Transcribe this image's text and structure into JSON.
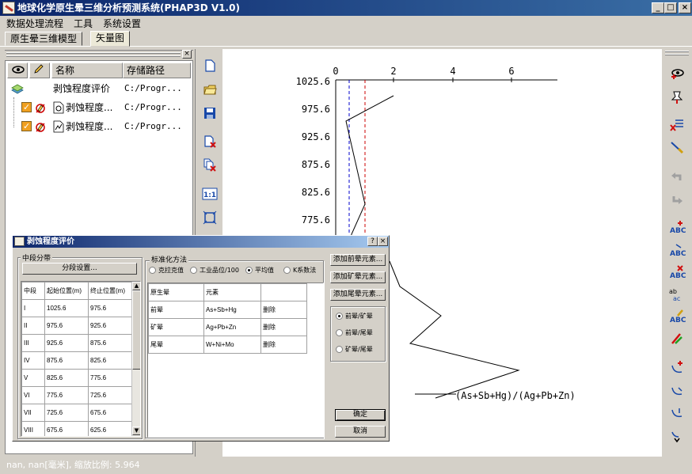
{
  "window": {
    "title": "地球化学原生晕三维分析预测系统(PHAP3D V1.0)",
    "controls": [
      "_",
      "□",
      "×"
    ]
  },
  "menu": [
    "数据处理流程",
    "工具",
    "系统设置"
  ],
  "tabs": [
    "原生晕三维模型",
    "矢量图"
  ],
  "tree": {
    "columns": [
      "名称",
      "存储路径"
    ],
    "rows": [
      {
        "name": "剥蚀程度评价",
        "path": "C:/Progr..."
      },
      {
        "name": "剥蚀程度...",
        "path": "C:/Progr..."
      },
      {
        "name": "剥蚀程度...",
        "path": "C:/Progr..."
      }
    ]
  },
  "canvas": {
    "formula": "(As+Sb+Hg)/(Ag+Pb+Zn)",
    "x_ticks": [
      "0",
      "2",
      "4",
      "6"
    ],
    "y_ticks": [
      "1025.6",
      "975.6",
      "925.6",
      "875.6",
      "825.6",
      "775.6"
    ]
  },
  "statusbar": {
    "text": "nan, nan[毫米], 缩放比例: 5.964"
  },
  "dialog": {
    "title": "剥蚀程度评价",
    "segment_group": "中段分带",
    "segment_button": "分段设置...",
    "segment_headers": [
      "中段",
      "起始位置(m)",
      "终止位置(m)"
    ],
    "segments": [
      [
        "I",
        "1025.6",
        "975.6"
      ],
      [
        "II",
        "975.6",
        "925.6"
      ],
      [
        "III",
        "925.6",
        "875.6"
      ],
      [
        "IV",
        "875.6",
        "825.6"
      ],
      [
        "V",
        "825.6",
        "775.6"
      ],
      [
        "VI",
        "775.6",
        "725.6"
      ],
      [
        "VII",
        "725.6",
        "675.6"
      ],
      [
        "VIII",
        "675.6",
        "625.6"
      ]
    ],
    "normalize_group": "标准化方法",
    "normalize_options": [
      {
        "label": "克拉克值",
        "selected": false
      },
      {
        "label": "工业品位/100",
        "selected": false
      },
      {
        "label": "平均值",
        "selected": true
      },
      {
        "label": "K系数法",
        "selected": false
      }
    ],
    "halo_headers": [
      "原生晕",
      "元素",
      ""
    ],
    "halo_rows": [
      [
        "前晕",
        "As+Sb+Hg",
        "删除"
      ],
      [
        "矿晕",
        "Ag+Pb+Zn",
        "删除"
      ],
      [
        "尾晕",
        "W+Ni+Mo",
        "删除"
      ]
    ],
    "add_buttons": [
      "添加前晕元素...",
      "添加矿晕元素...",
      "添加尾晕元素..."
    ],
    "ratio_options": [
      {
        "label": "前晕/矿晕",
        "selected": true
      },
      {
        "label": "前晕/尾晕",
        "selected": false
      },
      {
        "label": "矿晕/尾晕",
        "selected": false
      }
    ],
    "ok": "确定",
    "cancel": "取消",
    "help": "?",
    "close": "×"
  },
  "colors": {
    "title_start": "#0a246a",
    "title_end": "#3a6ea5",
    "face": "#d4d0c8",
    "blue_dash": "#0000cc",
    "red_dash": "#cc0000"
  }
}
